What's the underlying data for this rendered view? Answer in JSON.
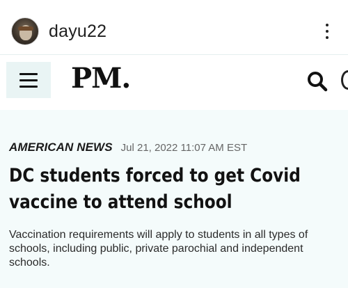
{
  "post": {
    "username": "dayu22",
    "avatar_icon": "user-avatar",
    "more_icon": "kebab-menu-icon"
  },
  "site": {
    "logo": "PM.",
    "menu_icon": "hamburger-icon",
    "search_icon": "search-icon"
  },
  "article": {
    "category": "AMERICAN NEWS",
    "date": "Jul 21, 2022 11:07 AM EST",
    "headline": "DC students forced to get Covid vaccine to attend school",
    "summary": "Vaccination requirements will apply to students in all types of schools, including public, private parochial and independent schools."
  }
}
